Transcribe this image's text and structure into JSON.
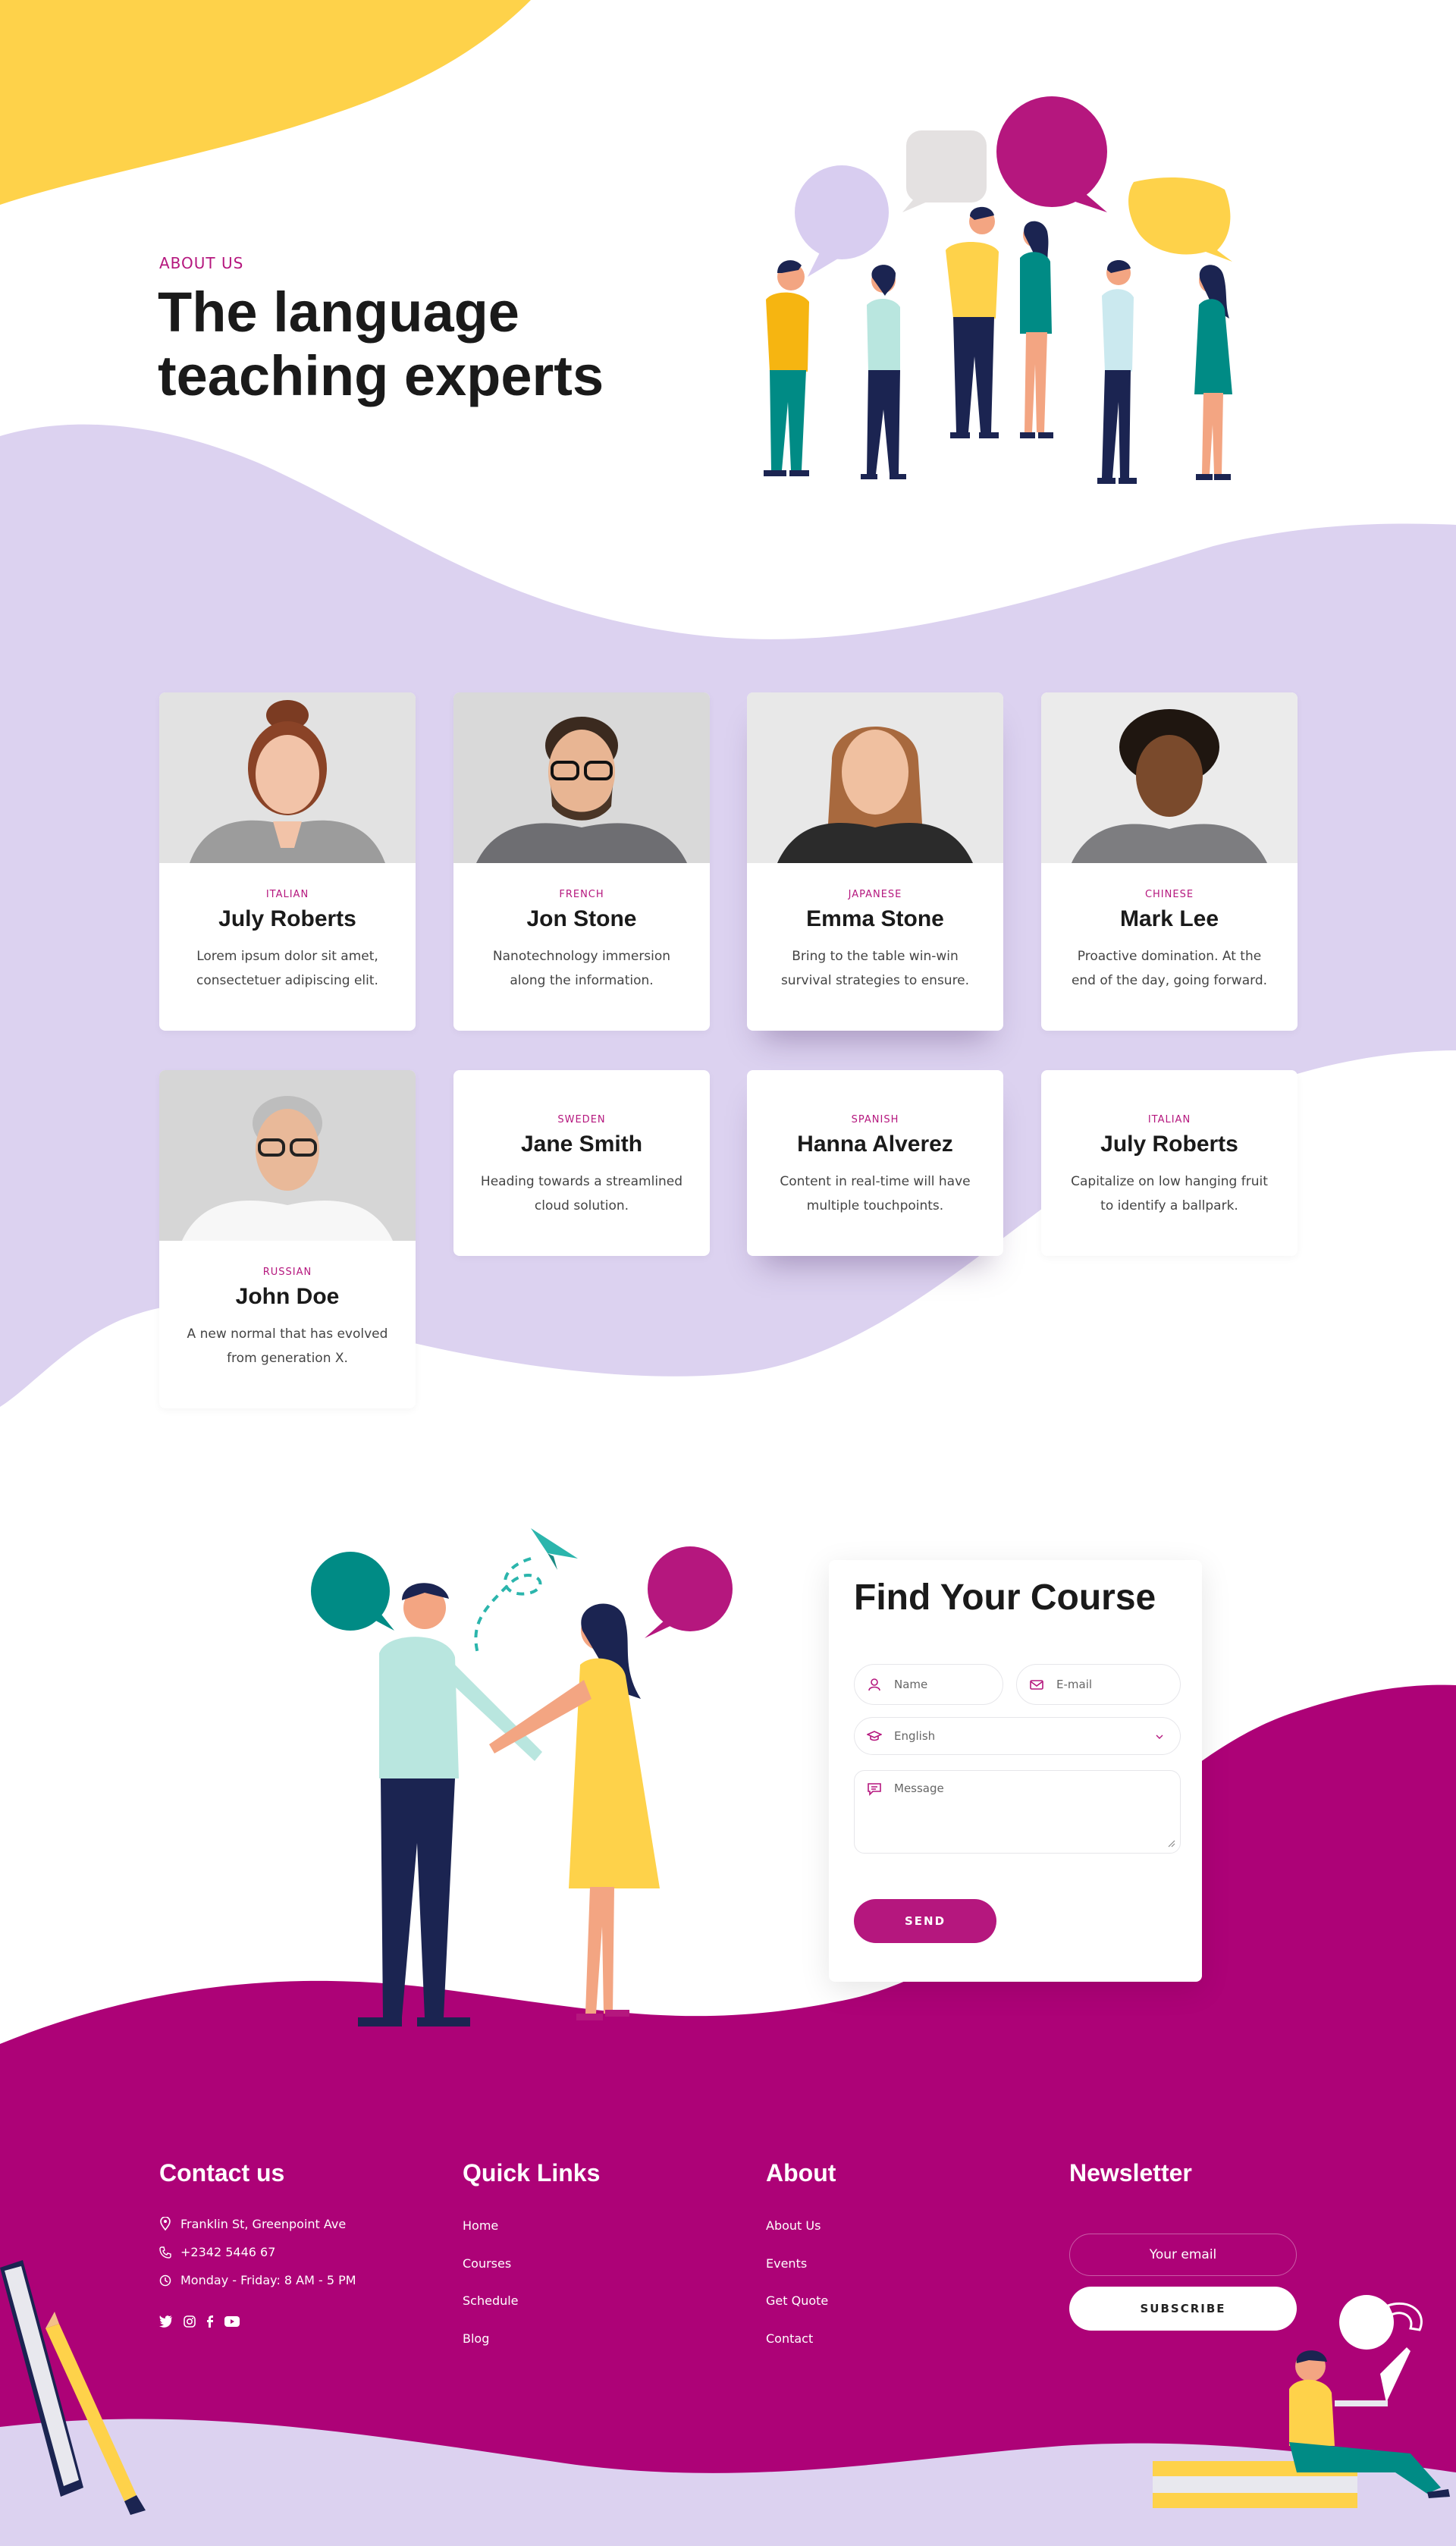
{
  "hero": {
    "eyebrow": "ABOUT US",
    "title": "The language teaching experts"
  },
  "teachers": [
    {
      "language": "ITALIAN",
      "name": "July Roberts",
      "description": "Lorem ipsum dolor sit amet, consectetuer adipiscing elit."
    },
    {
      "language": "FRENCH",
      "name": "Jon Stone",
      "description": "Nanotechnology immersion along the information."
    },
    {
      "language": "JAPANESE",
      "name": "Emma Stone",
      "description": "Bring to the table win-win survival strategies to ensure."
    },
    {
      "language": "CHINESE",
      "name": "Mark Lee",
      "description": "Proactive domination. At the end of the day, going forward."
    },
    {
      "language": "RUSSIAN",
      "name": "John Doe",
      "description": "A new normal that has evolved from generation X."
    },
    {
      "language": "SWEDEN",
      "name": "Jane Smith",
      "description": "Heading towards a streamlined cloud solution."
    },
    {
      "language": "SPANISH",
      "name": "Hanna Alverez",
      "description": "Content in real-time will have multiple touchpoints."
    },
    {
      "language": "ITALIAN",
      "name": "July Roberts",
      "description": "Capitalize on low hanging fruit to identify a ballpark."
    }
  ],
  "course_form": {
    "title": "Find Your Course",
    "name_placeholder": "Name",
    "email_placeholder": "E-mail",
    "language_selected": "English",
    "message_placeholder": "Message",
    "send_label": "SEND"
  },
  "footer": {
    "contact": {
      "title": "Contact us",
      "address": "Franklin St, Greenpoint Ave",
      "phone": "+2342 5446 67",
      "hours": "Monday - Friday: 8 AM - 5 PM",
      "social_icons": [
        "twitter-icon",
        "instagram-icon",
        "facebook-icon",
        "youtube-icon"
      ]
    },
    "quick_links": {
      "title": "Quick Links",
      "items": [
        "Home",
        "Courses",
        "Schedule",
        "Blog"
      ]
    },
    "about": {
      "title": "About",
      "items": [
        "About Us",
        "Events",
        "Get Quote",
        "Contact"
      ]
    },
    "newsletter": {
      "title": "Newsletter",
      "email_placeholder": "Your email",
      "subscribe_label": "SUBSCRIBE"
    }
  },
  "colors": {
    "accent": "#b5177e",
    "footer_bg": "#ad0277",
    "lavender": "#dcd2f0",
    "yellow": "#fed24a",
    "teal": "#008b85"
  }
}
